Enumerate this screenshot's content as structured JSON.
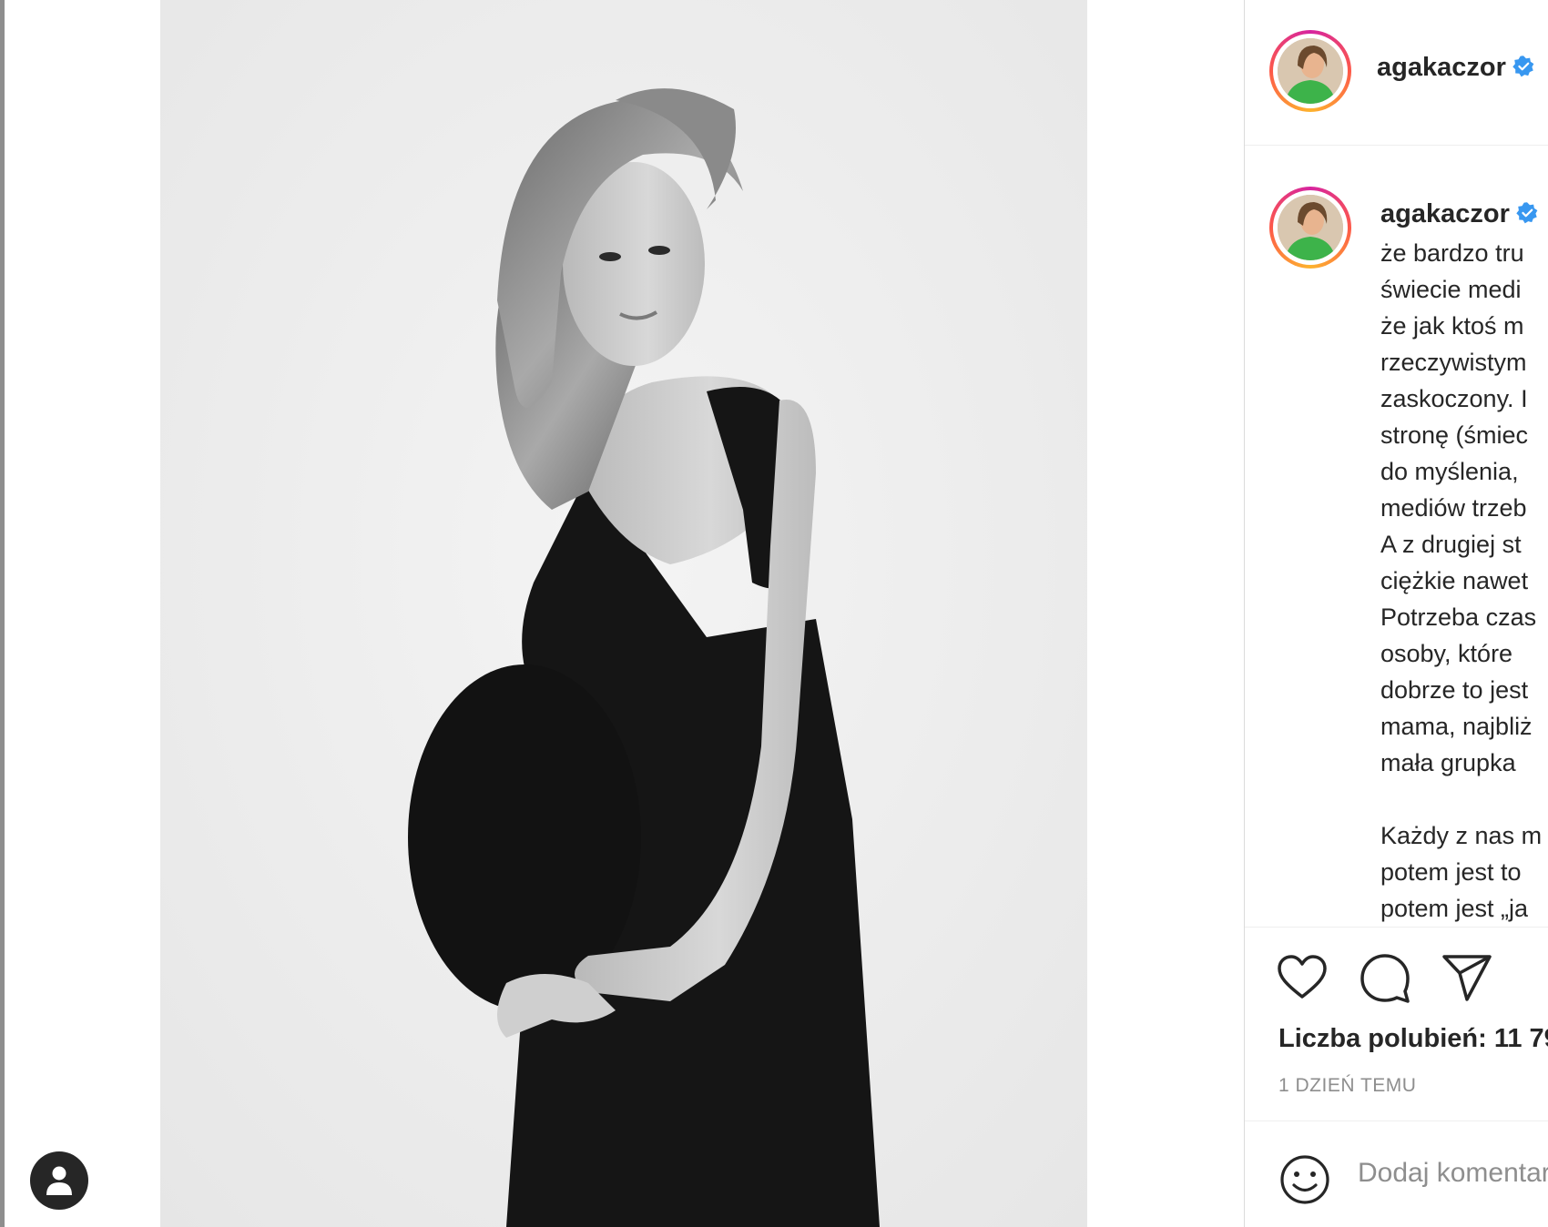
{
  "post": {
    "username": "agakaczor",
    "verified": true
  },
  "caption": {
    "username": "agakaczor",
    "lines": [
      "że bardzo tru",
      "świecie medi",
      "że jak ktoś m",
      "rzeczywistym",
      "zaskoczony. I",
      "stronę (śmiec",
      "do myślenia,",
      "mediów trzeb",
      "A z drugiej st",
      "ciężkie nawet",
      "Potrzeba czas",
      "osoby, które",
      "dobrze to jest",
      "mama, najbliż",
      "mała grupka",
      "",
      "Każdy z nas m",
      "potem jest to",
      "potem jest „ja"
    ]
  },
  "actions": {
    "like_icon": "heart-icon",
    "comment_icon": "comment-icon",
    "share_icon": "share-icon"
  },
  "likes_text": "Liczba polubień: 11 79",
  "time_text": "1 DZIEŃ TEMU",
  "comment": {
    "emoji_icon": "emoji-icon",
    "placeholder": "Dodaj komentarz"
  },
  "account_icon": "account-icon",
  "colors": {
    "verified": "#3897f0",
    "text": "#262626",
    "muted": "#8e8e8e",
    "divider": "#efefef"
  }
}
